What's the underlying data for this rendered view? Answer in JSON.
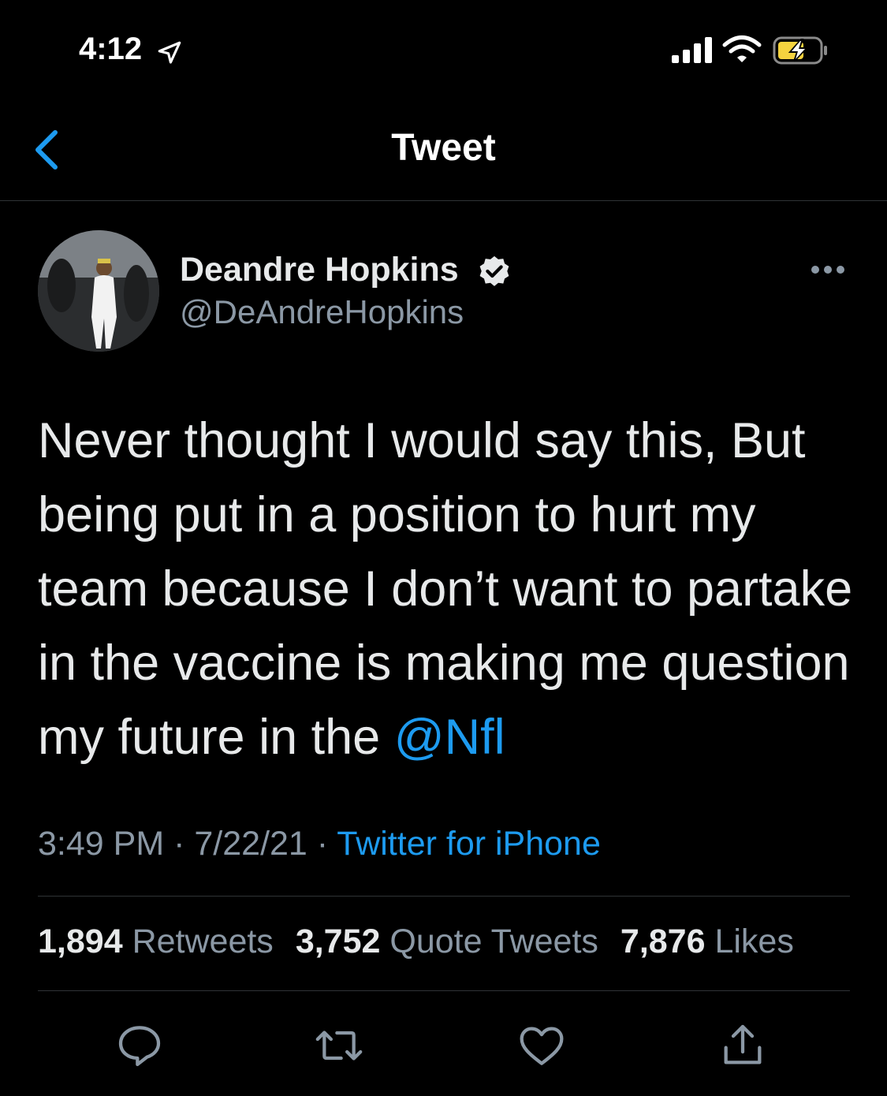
{
  "status_bar": {
    "time": "4:12"
  },
  "nav": {
    "title": "Tweet"
  },
  "author": {
    "name": "Deandre Hopkins",
    "handle": "@DeAndreHopkins"
  },
  "tweet": {
    "text_before_mention": "Never thought I would say this, But being put in a position to hurt my team because I don’t want to partake in the vaccine is making me question my future in the ",
    "mention": "@Nfl"
  },
  "meta": {
    "time": "3:49 PM",
    "separator": "·",
    "date": "7/22/21",
    "source": "Twitter for iPhone"
  },
  "stats": {
    "retweets_count": "1,894",
    "retweets_label": "Retweets",
    "quotes_count": "3,752",
    "quotes_label": "Quote Tweets",
    "likes_count": "7,876",
    "likes_label": "Likes"
  },
  "colors": {
    "background": "#000000",
    "accent": "#1d9bf0",
    "secondary_text": "#8b98a5",
    "battery_charging": "#f5d33f"
  },
  "icons": [
    "location-arrow-icon",
    "signal-icon",
    "wifi-icon",
    "battery-charging-icon",
    "back-chevron-icon",
    "verified-badge-icon",
    "more-icon",
    "reply-icon",
    "retweet-icon",
    "like-icon",
    "share-icon"
  ]
}
